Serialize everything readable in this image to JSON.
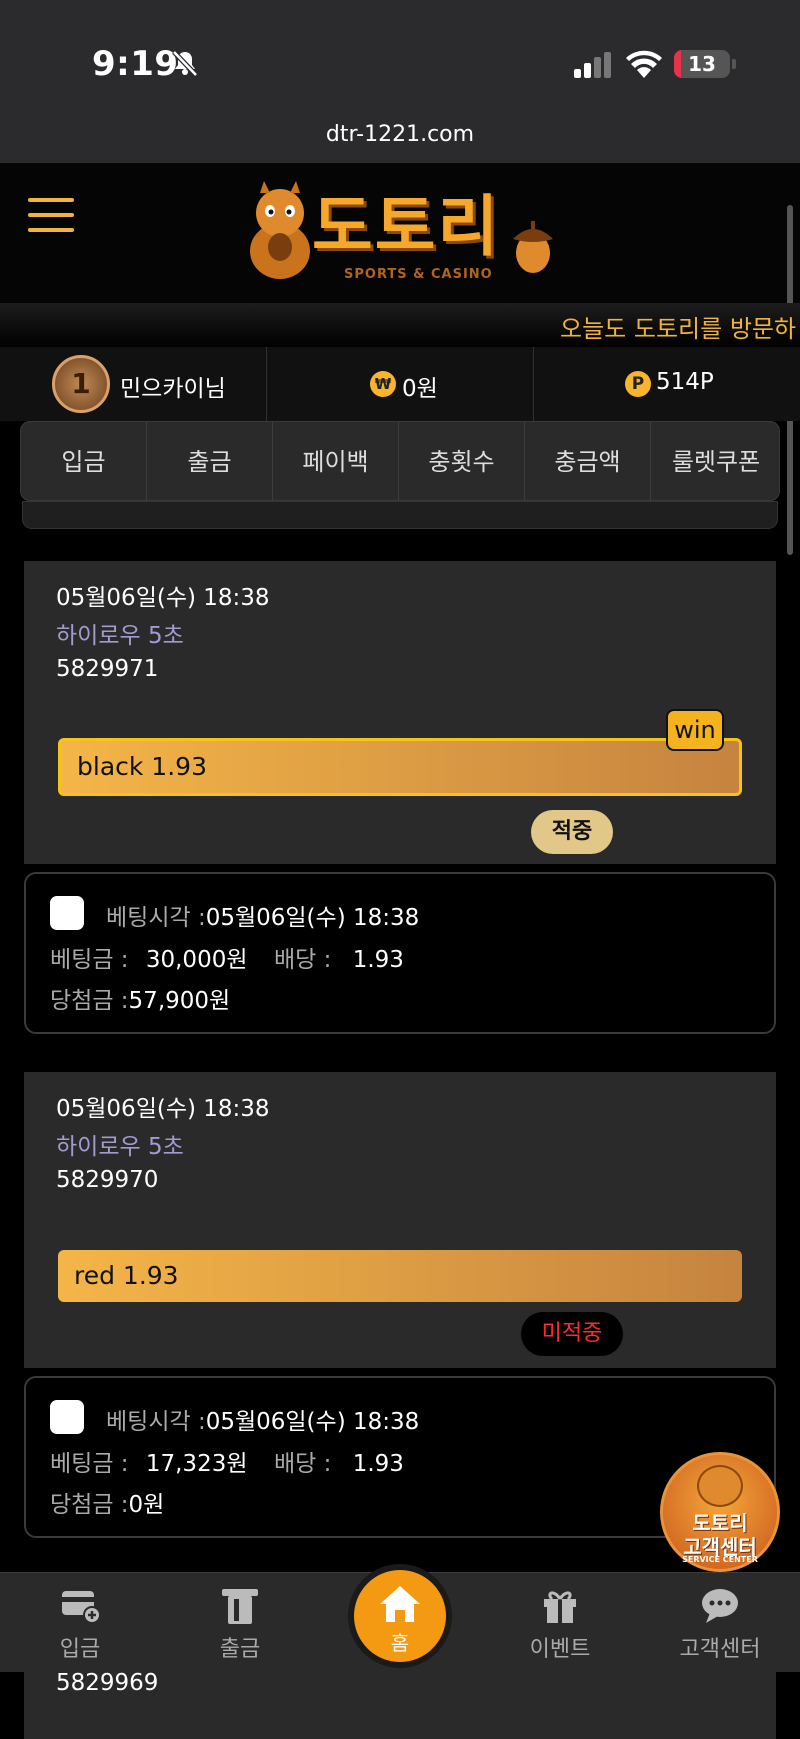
{
  "status": {
    "time": "9:19",
    "battery": "13",
    "battery_pct": 0.13,
    "url": "dtr-1221.com"
  },
  "brand": {
    "logo_text": "도토리",
    "logo_sub": "SPORTS & CASINO"
  },
  "marquee": "오늘도 도토리를 방문하",
  "user": {
    "level": "1",
    "name": "민으카이님",
    "money": "0원",
    "points": "514P",
    "won_symbol": "₩",
    "p_symbol": "P"
  },
  "menu": [
    "입금",
    "출금",
    "페이백",
    "충횟수",
    "충금액",
    "룰렛쿠폰"
  ],
  "bets": [
    {
      "date": "05월06일(수) 18:38",
      "game": "하이로우 5초",
      "id": "5829971",
      "pick": "black 1.93",
      "win_tag": "win",
      "result": "적중",
      "detail": {
        "time_label": "베팅시각 :",
        "time": "05월06일(수) 18:38",
        "amount_label": "베팅금 :",
        "amount": "30,000원",
        "odds_label": "배당 :",
        "odds": "1.93",
        "payout_label": "당첨금 :",
        "payout": "57,900원"
      }
    },
    {
      "date": "05월06일(수) 18:38",
      "game": "하이로우 5초",
      "id": "5829970",
      "pick": "red 1.93",
      "result": "미적중",
      "detail": {
        "time_label": "베팅시각 :",
        "time": "05월06일(수) 18:38",
        "amount_label": "베팅금 :",
        "amount": "17,323원",
        "odds_label": "배당 :",
        "odds": "1.93",
        "payout_label": "당첨금 :",
        "payout": "0원"
      }
    }
  ],
  "next_id": "5829969",
  "support_badge": {
    "line1": "도토리",
    "line2": "고객센터",
    "line3": "SERVICE CENTER"
  },
  "nav": {
    "deposit": "입금",
    "withdraw": "출금",
    "home": "홈",
    "event": "이벤트",
    "support": "고객센터"
  },
  "colors": {
    "accent": "#f7a82b",
    "win_border": "#f7c319",
    "miss_text": "#ff2a2a",
    "game_text": "#a59ad0"
  }
}
